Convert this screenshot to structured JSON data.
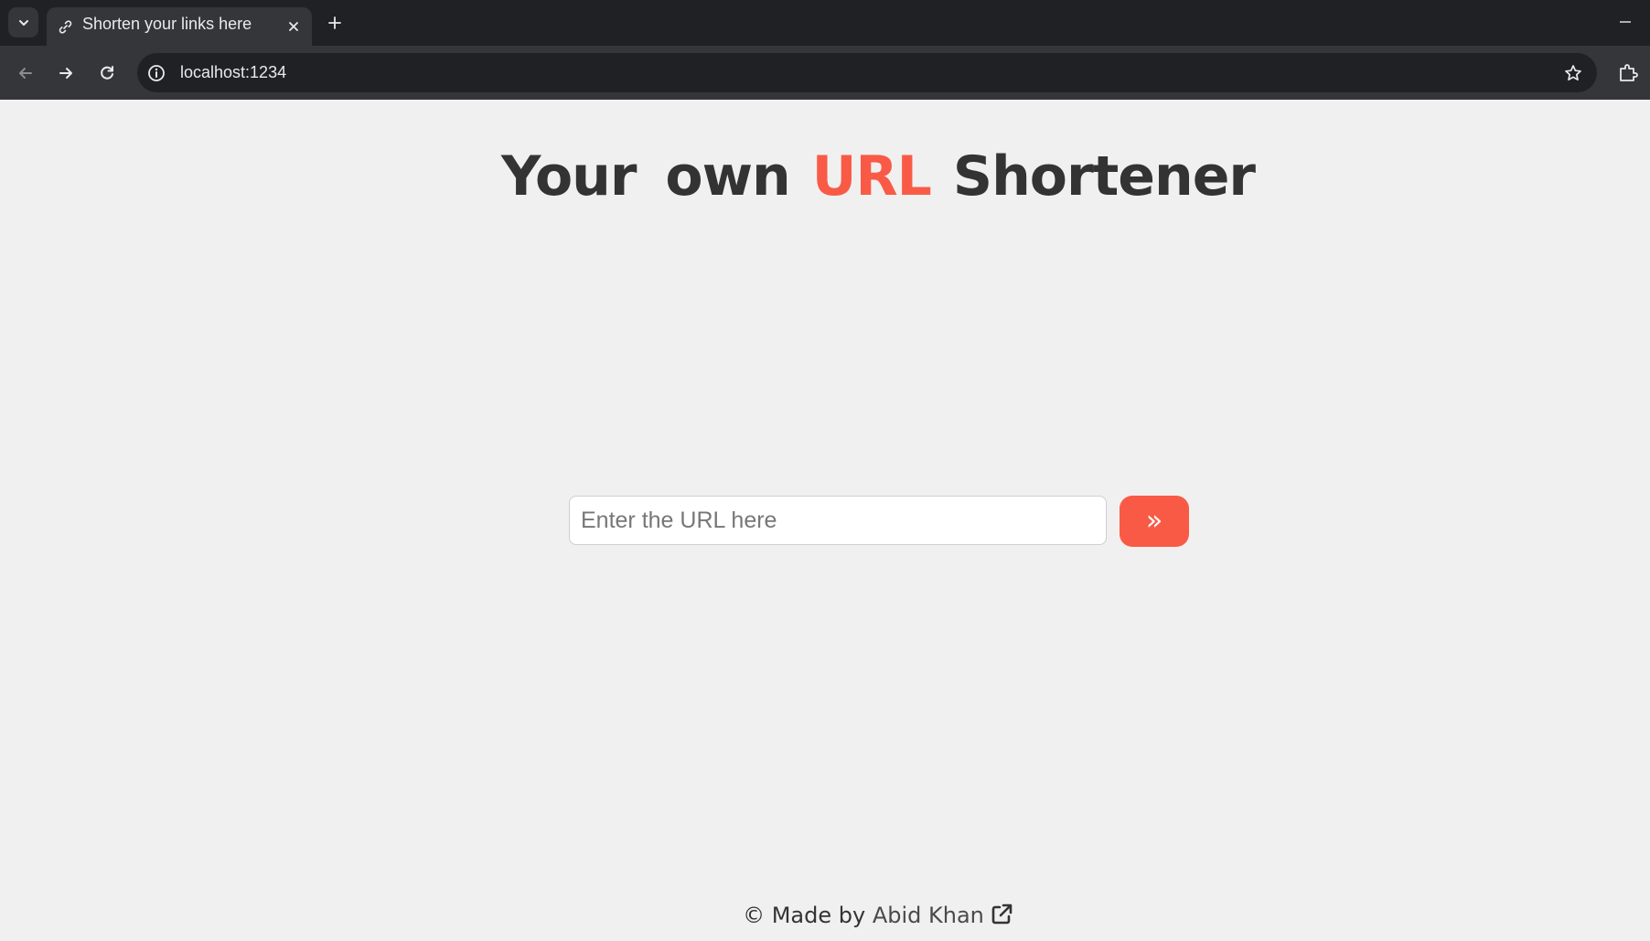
{
  "browser": {
    "tab": {
      "title": "Shorten your links here",
      "favicon": "link-icon"
    },
    "omnibox": {
      "url": "localhost:1234"
    }
  },
  "page": {
    "heading": {
      "part1": "Your own",
      "accent": "URL",
      "part2": "Shortener"
    },
    "form": {
      "input_placeholder": "Enter the URL here",
      "input_value": "",
      "submit_label": "»"
    },
    "footer": {
      "prefix": "© Made by",
      "author": "Abid Khan",
      "link_icon": "external-link-icon"
    }
  },
  "colors": {
    "accent": "#f95a46",
    "text": "#333333",
    "background": "#f0f0f0"
  }
}
